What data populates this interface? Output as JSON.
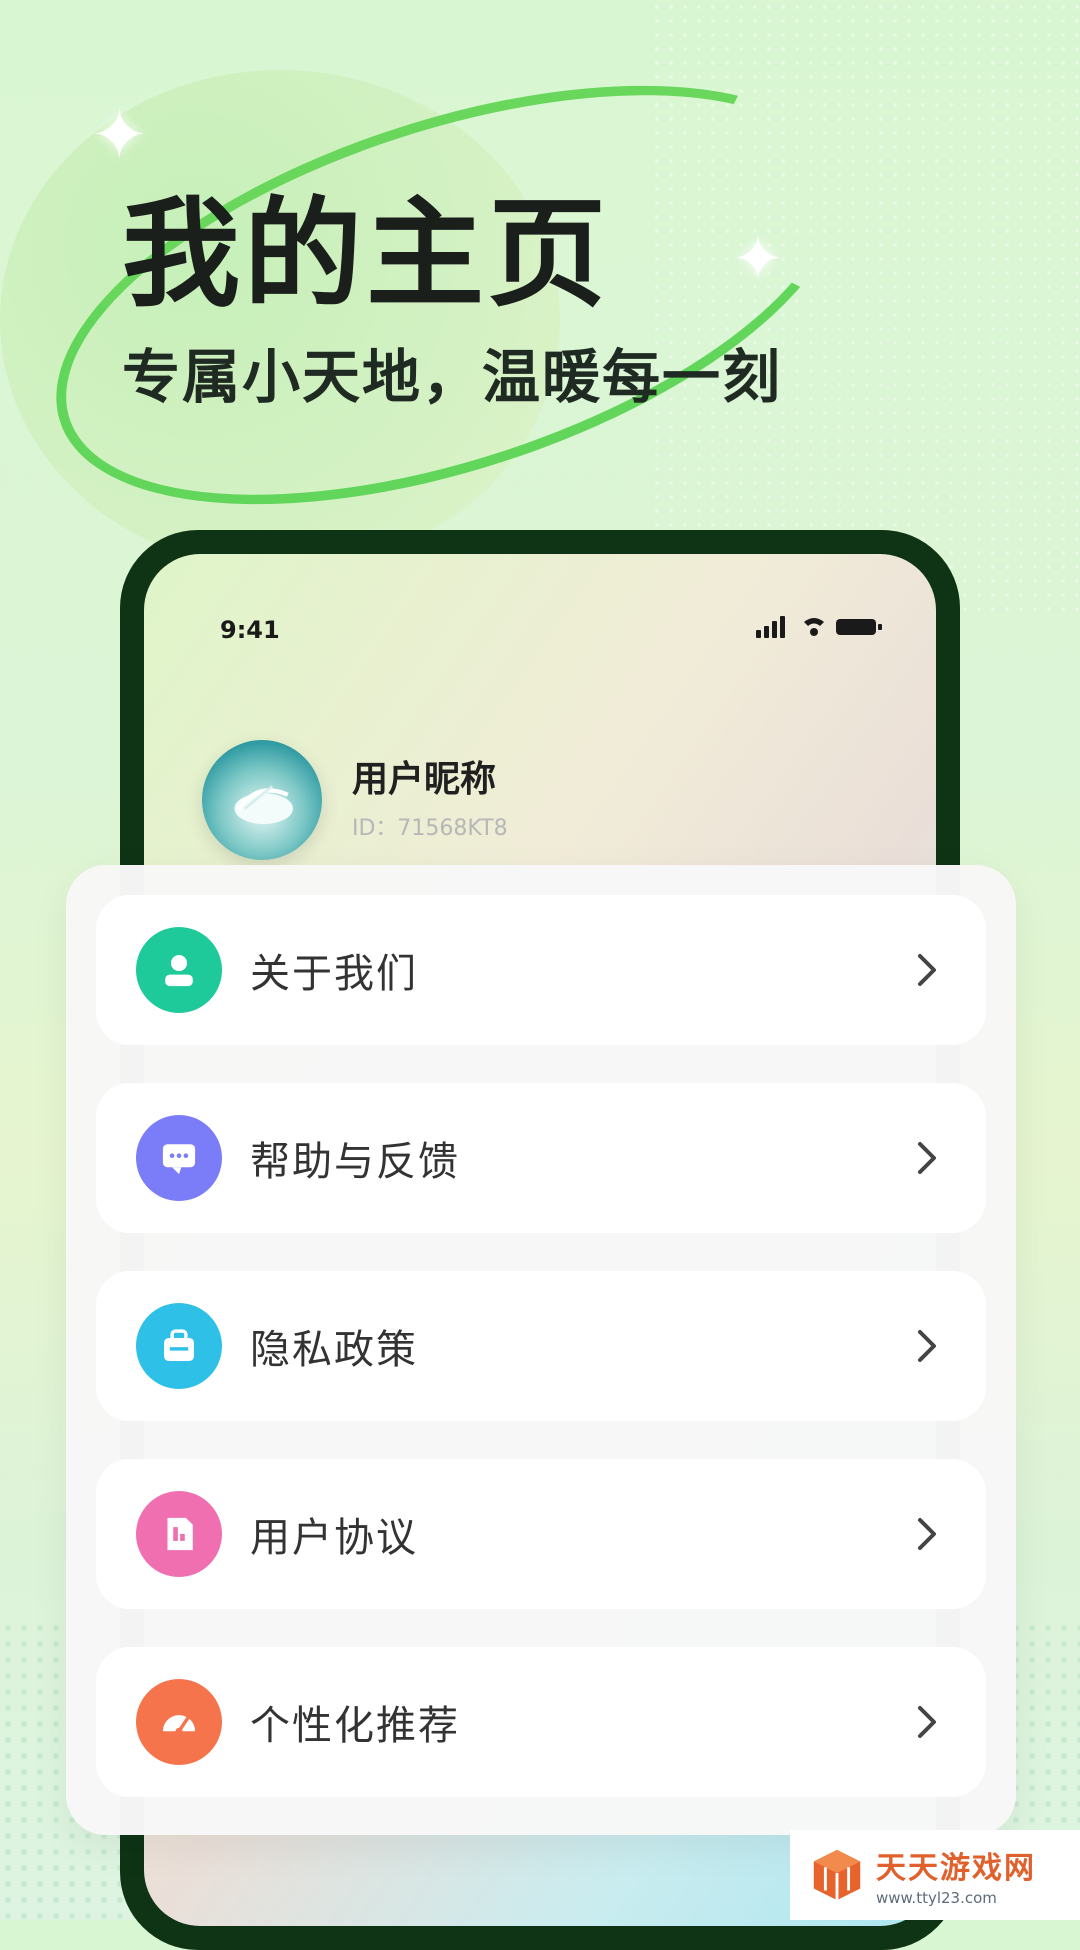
{
  "banner": {
    "title": "我的主页",
    "subtitle": "专属小天地，温暖每一刻"
  },
  "phone": {
    "status_time": "9:41",
    "profile": {
      "nickname": "用户昵称",
      "id_text": "ID：71568KT8"
    }
  },
  "menu": {
    "items": [
      {
        "label": "关于我们",
        "icon": "user-icon",
        "color": "#1ec99a"
      },
      {
        "label": "帮助与反馈",
        "icon": "chat-icon",
        "color": "#7b7cf7"
      },
      {
        "label": "隐私政策",
        "icon": "briefcase-icon",
        "color": "#2fc0e8"
      },
      {
        "label": "用户协议",
        "icon": "document-icon",
        "color": "#ef6fb0"
      },
      {
        "label": "个性化推荐",
        "icon": "gauge-icon",
        "color": "#f5744c"
      }
    ]
  },
  "watermark": {
    "title": "天天游戏网",
    "url": "www.ttyl23.com"
  }
}
